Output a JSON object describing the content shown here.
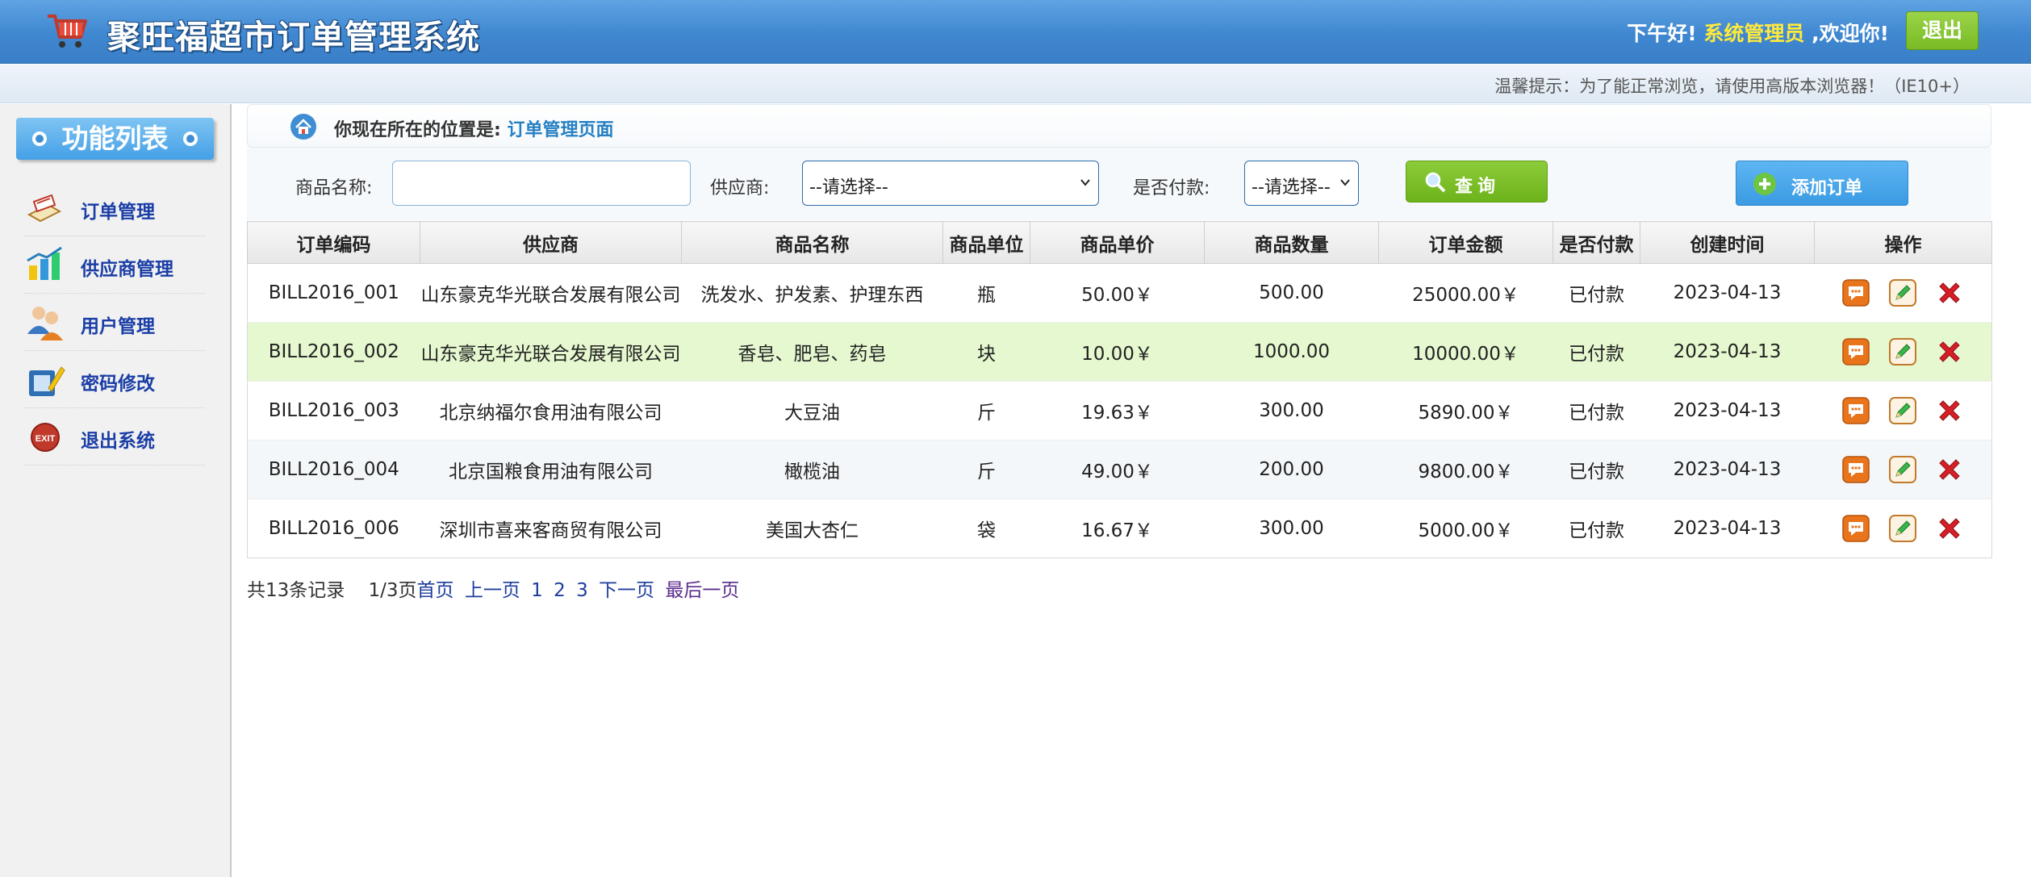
{
  "header": {
    "title": "聚旺福超市订单管理系统",
    "greeting_prefix": "下午好!",
    "user": "系统管理员",
    "greeting_suffix": ",欢迎你!",
    "logout_label": "退出"
  },
  "notice": "温馨提示：为了能正常浏览，请使用高版本浏览器！（IE10+）",
  "sidebar": {
    "title": "功能列表",
    "items": [
      {
        "label": "订单管理",
        "icon": "order-icon"
      },
      {
        "label": "供应商管理",
        "icon": "supplier-icon"
      },
      {
        "label": "用户管理",
        "icon": "users-icon"
      },
      {
        "label": "密码修改",
        "icon": "password-icon"
      },
      {
        "label": "退出系统",
        "icon": "exit-icon"
      }
    ]
  },
  "breadcrumb": {
    "prefix": "你现在所在的位置是:",
    "current": "订单管理页面"
  },
  "search": {
    "product_label": "商品名称:",
    "product_value": "",
    "supplier_label": "供应商:",
    "supplier_selected": "--请选择--",
    "paid_label": "是否付款:",
    "paid_selected": "--请选择--",
    "query_label": "查询",
    "add_label": "添加订单"
  },
  "table": {
    "headers": [
      "订单编码",
      "供应商",
      "商品名称",
      "商品单位",
      "商品单价",
      "商品数量",
      "订单金额",
      "是否付款",
      "创建时间",
      "操作"
    ],
    "rows": [
      [
        "BILL2016_001",
        "山东豪克华光联合发展有限公司",
        "洗发水、护发素、护理东西",
        "瓶",
        "50.00￥",
        "500.00",
        "25000.00￥",
        "已付款",
        "2023-04-13"
      ],
      [
        "BILL2016_002",
        "山东豪克华光联合发展有限公司",
        "香皂、肥皂、药皂",
        "块",
        "10.00￥",
        "1000.00",
        "10000.00￥",
        "已付款",
        "2023-04-13"
      ],
      [
        "BILL2016_003",
        "北京纳福尔食用油有限公司",
        "大豆油",
        "斤",
        "19.63￥",
        "300.00",
        "5890.00￥",
        "已付款",
        "2023-04-13"
      ],
      [
        "BILL2016_004",
        "北京国粮食用油有限公司",
        "橄榄油",
        "斤",
        "49.00￥",
        "200.00",
        "9800.00￥",
        "已付款",
        "2023-04-13"
      ],
      [
        "BILL2016_006",
        "深圳市喜来客商贸有限公司",
        "美国大杏仁",
        "袋",
        "16.67￥",
        "300.00",
        "5000.00￥",
        "已付款",
        "2023-04-13"
      ]
    ]
  },
  "pager": {
    "total": "共13条记录",
    "page": "1/3页",
    "first": "首页",
    "prev": "上一页",
    "p1": "1",
    "p2": "2",
    "p3": "3",
    "next": "下一页",
    "last": "最后一页"
  },
  "colors": {
    "header_blue": "#4a93dc",
    "accent_green": "#78bb24",
    "accent_blue": "#3a9be3",
    "highlight_row": "#e5f8cf"
  }
}
